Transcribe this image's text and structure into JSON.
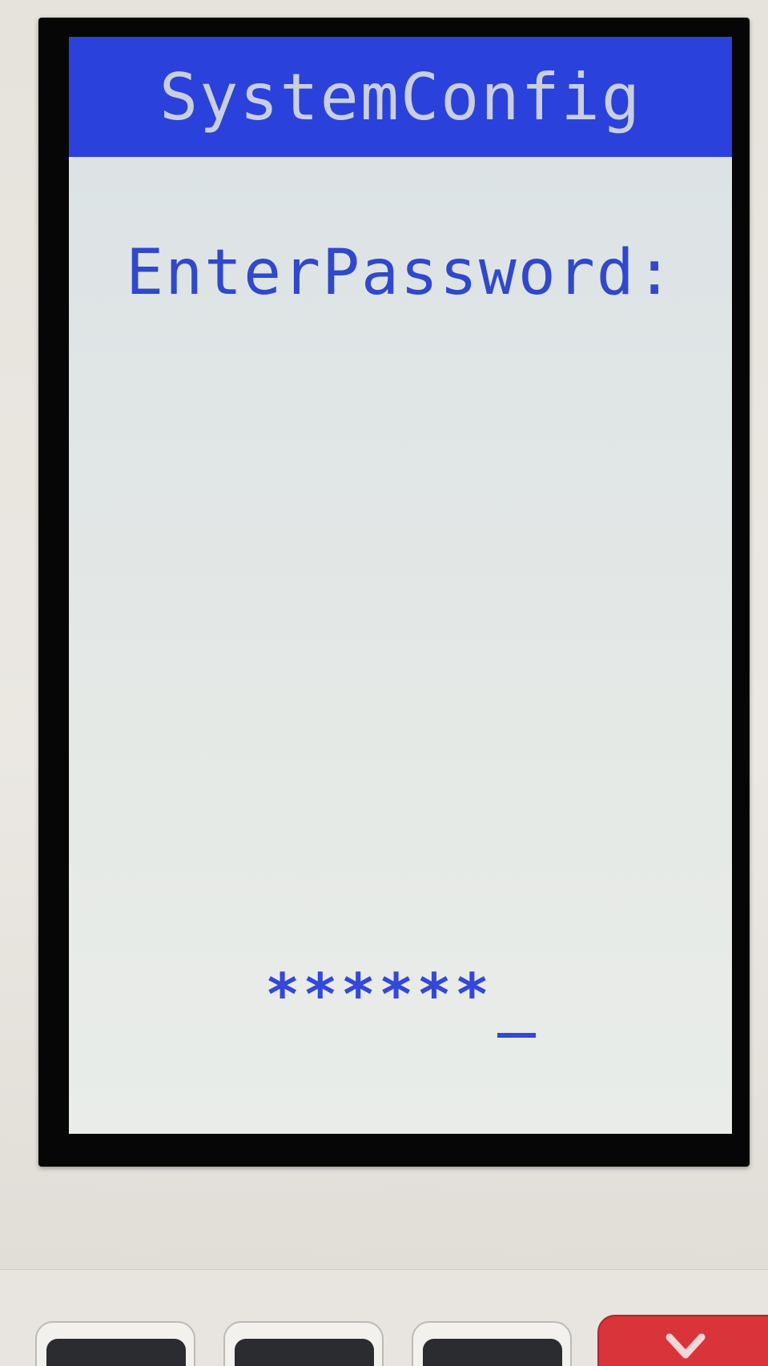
{
  "screen": {
    "title": "SystemConfig",
    "prompt": "EnterPassword:",
    "password_value": "******",
    "cursor_icon": "text-cursor-icon"
  },
  "colors": {
    "title_bar": "#2a41dc",
    "title_text": "#c9cfe0",
    "screen_background": "#e1e6e6",
    "screen_text": "#2f48cc",
    "cancel_key": "#d8343a"
  },
  "keypad": {
    "keys": [
      {
        "icon": "keypad-key-icon"
      },
      {
        "icon": "keypad-key-icon"
      },
      {
        "icon": "keypad-key-icon"
      },
      {
        "icon": "cancel-x-icon"
      }
    ]
  }
}
